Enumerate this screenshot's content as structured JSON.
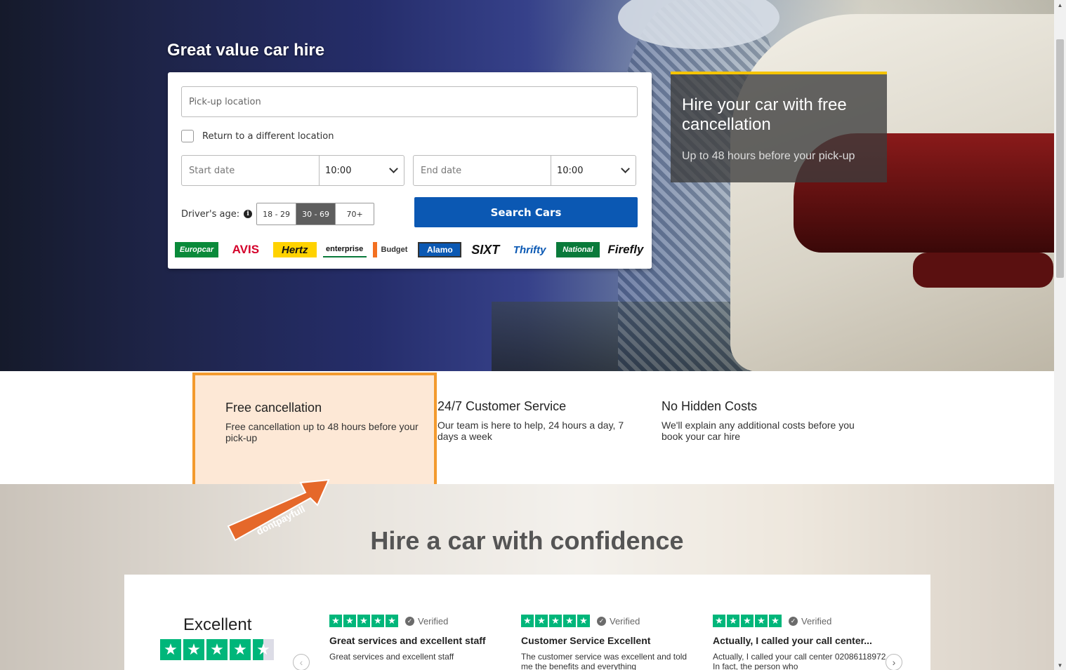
{
  "hero": {
    "title": "Great value car hire"
  },
  "search": {
    "pickup_placeholder": "Pick-up location",
    "return_label": "Return to a different location",
    "start_date_placeholder": "Start date",
    "start_time": "10:00",
    "end_date_placeholder": "End date",
    "end_time": "10:00",
    "age_label": "Driver's age:",
    "age_options": [
      "18 - 29",
      "30 - 69",
      "70+"
    ],
    "age_selected": "30 - 69",
    "search_button": "Search Cars",
    "brands": [
      "Europcar",
      "AVIS",
      "Hertz",
      "enterprise",
      "Budget",
      "Alamo",
      "SIXT",
      "Thrifty",
      "National",
      "Firefly"
    ]
  },
  "promo": {
    "title": "Hire your car with free cancellation",
    "subtitle": "Up to 48 hours before your pick-up"
  },
  "features": [
    {
      "title": "Free cancellation",
      "desc": "Free cancellation up to 48 hours before your pick-up"
    },
    {
      "title": "24/7 Customer Service",
      "desc": "Our team is here to help, 24 hours a day, 7 days a week"
    },
    {
      "title": "No Hidden Costs",
      "desc": "We'll explain any additional costs before you book your car hire"
    }
  ],
  "confidence": {
    "title": "Hire a car with confidence",
    "rating_label": "Excellent",
    "reviews": [
      {
        "verified": "Verified",
        "title": "Great services and excellent staff",
        "text": "Great services and excellent staff"
      },
      {
        "verified": "Verified",
        "title": "Customer Service Excellent",
        "text": "The customer service was excellent and told me the benefits and everything"
      },
      {
        "verified": "Verified",
        "title": "Actually, I called your call center...",
        "text": "Actually, I called your call center 02086118972 In fact, the person who"
      }
    ]
  },
  "watermark": "dontpayfull",
  "colors": {
    "primary_button": "#0b58b3",
    "highlight_border": "#f39a2e",
    "highlight_bg": "#fde8d6",
    "trustpilot_green": "#00b67a",
    "promo_accent": "#f5c400"
  }
}
